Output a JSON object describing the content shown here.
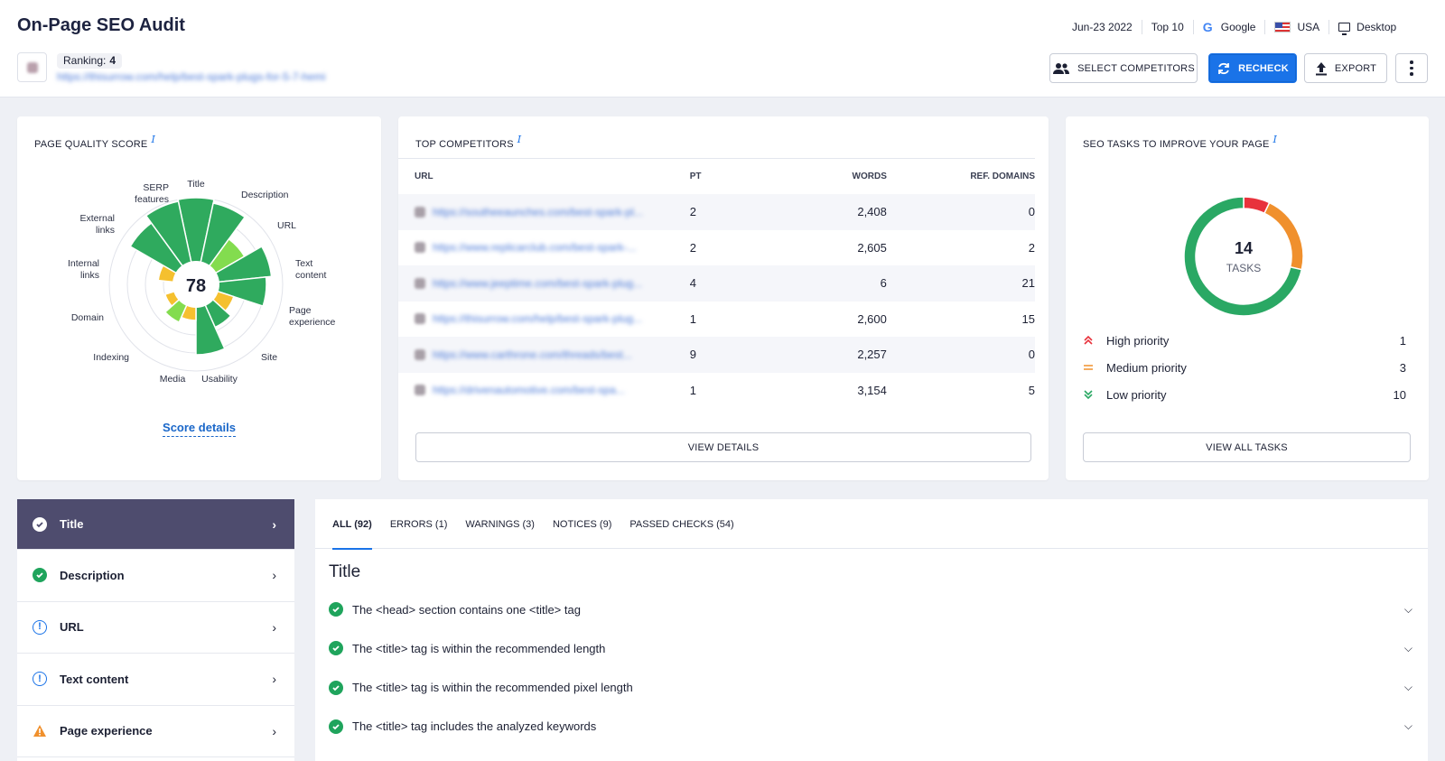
{
  "header": {
    "title": "On-Page SEO Audit",
    "ranking_label": "Ranking:",
    "ranking_value": "4",
    "url": "https://thisurrow.com/help/best-spark-plugs-for-5-7-hemi",
    "date": "Jun-23 2022",
    "top": "Top 10",
    "engine": "Google",
    "country": "USA",
    "device": "Desktop",
    "buttons": {
      "select_competitors": "SELECT COMPETITORS",
      "recheck": "RECHECK",
      "export": "EXPORT"
    }
  },
  "quality": {
    "title": "PAGE QUALITY SCORE",
    "info": "i",
    "score": "78",
    "score_details": "Score details",
    "labels": {
      "title": "Title",
      "description": "Description",
      "url": "URL",
      "text_content_1": "Text",
      "text_content_2": "content",
      "page_exp_1": "Page",
      "page_exp_2": "experience",
      "site": "Site",
      "usability": "Usability",
      "media": "Media",
      "indexing": "Indexing",
      "domain": "Domain",
      "internal_1": "Internal",
      "internal_2": "links",
      "external_1": "External",
      "external_2": "links",
      "serp_1": "SERP",
      "serp_2": "features"
    }
  },
  "competitors": {
    "title": "TOP COMPETITORS",
    "info": "i",
    "headers": {
      "url": "URL",
      "pt": "PT",
      "words": "WORDS",
      "ref": "REF. DOMAINS"
    },
    "rows": [
      {
        "url": "https://southeeaunches.com/best-spark-pl...",
        "pt": "2",
        "words": "2,408",
        "ref": "0"
      },
      {
        "url": "https://www.replicarclub.com/best-spark-...",
        "pt": "2",
        "words": "2,605",
        "ref": "2"
      },
      {
        "url": "https://www.jeeptime.com/best-spark-plug...",
        "pt": "4",
        "words": "6",
        "ref": "21"
      },
      {
        "url": "https://thisurrow.com/help/best-spark-plug...",
        "pt": "1",
        "words": "2,600",
        "ref": "15"
      },
      {
        "url": "https://www.carthrone.com/threads/best...",
        "pt": "9",
        "words": "2,257",
        "ref": "0"
      },
      {
        "url": "https://drivenautomotive.com/best-spa...",
        "pt": "1",
        "words": "3,154",
        "ref": "5"
      }
    ],
    "view_details": "VIEW DETAILS"
  },
  "tasks": {
    "title": "SEO TASKS TO IMPROVE YOUR PAGE",
    "info": "i",
    "count": "14",
    "count_label": "TASKS",
    "high_label": "High priority",
    "high_value": "1",
    "medium_label": "Medium priority",
    "medium_value": "3",
    "low_label": "Low priority",
    "low_value": "10",
    "view_all": "VIEW ALL TASKS",
    "colors": {
      "high": "#e8323c",
      "medium": "#f0902d",
      "low": "#2aa864"
    }
  },
  "sidebar": {
    "items": [
      {
        "label": "Title",
        "status": "passed-active"
      },
      {
        "label": "Description",
        "status": "passed"
      },
      {
        "label": "URL",
        "status": "info"
      },
      {
        "label": "Text content",
        "status": "info"
      },
      {
        "label": "Page experience",
        "status": "warning"
      }
    ]
  },
  "checks": {
    "tabs": [
      {
        "label": "ALL (92)"
      },
      {
        "label": "ERRORS (1)"
      },
      {
        "label": "WARNINGS (3)"
      },
      {
        "label": "NOTICES (9)"
      },
      {
        "label": "PASSED CHECKS (54)"
      }
    ],
    "section_title": "Title",
    "rows": [
      {
        "label": "The <head> section contains one <title> tag"
      },
      {
        "label": "The <title> tag is within the recommended length"
      },
      {
        "label": "The <title> tag is within the recommended pixel length"
      },
      {
        "label": "The <title> tag includes the analyzed keywords"
      }
    ]
  }
}
